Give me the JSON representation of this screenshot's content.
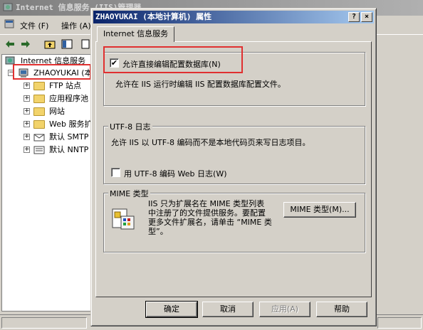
{
  "background_window": {
    "title": "Internet 信息服务 (IIS)管理器",
    "menu": [
      {
        "label": "文件 (F)"
      },
      {
        "label": "操作 (A)"
      }
    ],
    "tree": [
      {
        "label": "Internet 信息服务",
        "icon": "iis-icon"
      },
      {
        "label": "ZHAOYUKAI (本地计算机)",
        "icon": "computer-icon"
      },
      {
        "label": "FTP 站点",
        "icon": "folder-icon"
      },
      {
        "label": "应用程序池",
        "icon": "folder-icon"
      },
      {
        "label": "网站",
        "icon": "folder-icon"
      },
      {
        "label": "Web 服务扩展",
        "icon": "folder-icon"
      },
      {
        "label": "默认 SMTP",
        "icon": "smtp-icon"
      },
      {
        "label": "默认 NNTP",
        "icon": "nntp-icon"
      }
    ]
  },
  "dialog": {
    "title": "ZHAOYUKAI (本地计算机) 属性",
    "tab_label": "Internet 信息服务",
    "config": {
      "checkbox_label": "允许直接编辑配置数据库(N)",
      "checked": true,
      "description": "允许在 IIS 运行时编辑 IIS 配置数据库配置文件。"
    },
    "utf8": {
      "legend": "UTF-8 日志",
      "description": "允许 IIS 以 UTF-8 编码而不是本地代码页来写日志项目。",
      "checkbox_label": "用 UTF-8 编码 Web 日志(W)",
      "checked": false
    },
    "mime": {
      "legend": "MIME 类型",
      "description_lines": [
        "IIS 只为扩展名在 MIME 类型列表",
        "中注册了的文件提供服务。要配置",
        "更多文件扩展名，请单击 “MIME 类",
        "型”。"
      ],
      "button_label": "MIME 类型(M)..."
    },
    "buttons": {
      "ok": "确定",
      "cancel": "取消",
      "apply": "应用(A)",
      "help": "帮助"
    },
    "caption_help": "?",
    "caption_close": "×"
  },
  "colors": {
    "title_active": "#0a246a",
    "highlight": "#e03030",
    "face": "#d4d0c8"
  }
}
